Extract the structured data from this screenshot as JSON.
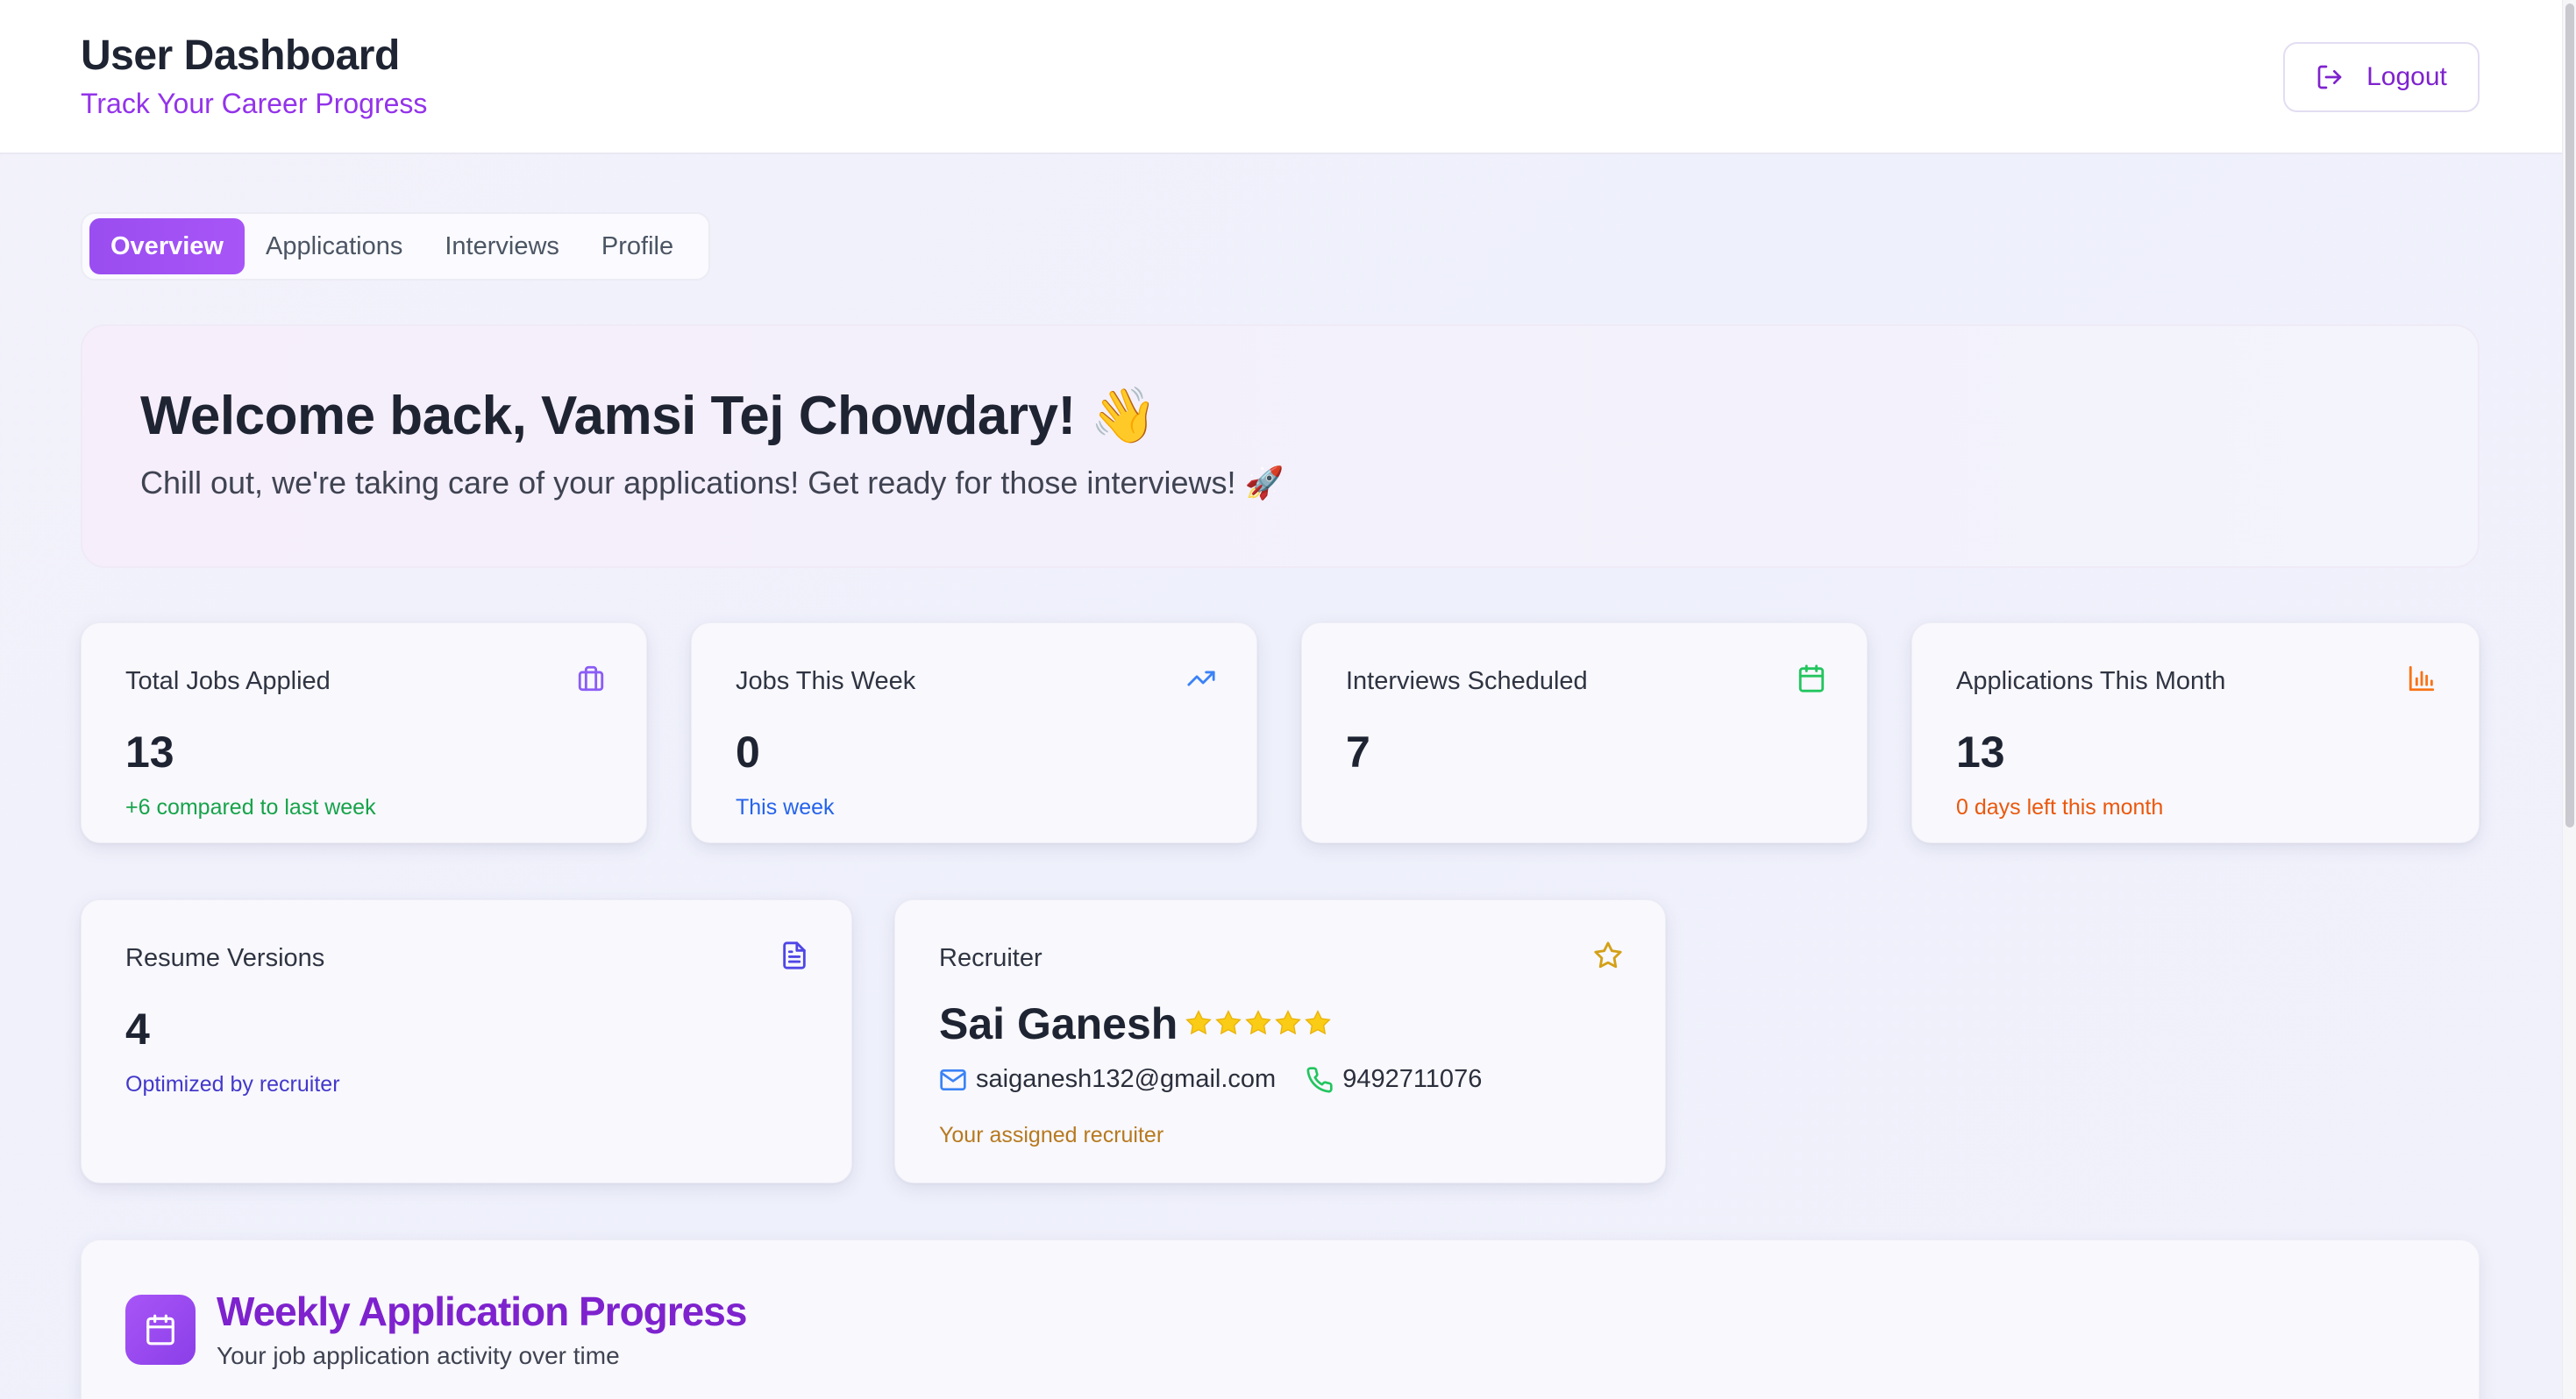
{
  "header": {
    "title": "User Dashboard",
    "subtitle": "Track Your Career Progress",
    "logout_label": "Logout"
  },
  "tabs": [
    {
      "label": "Overview",
      "active": true
    },
    {
      "label": "Applications",
      "active": false
    },
    {
      "label": "Interviews",
      "active": false
    },
    {
      "label": "Profile",
      "active": false
    }
  ],
  "welcome": {
    "title": "Welcome back, Vamsi Tej Chowdary! 👋",
    "text": "Chill out, we're taking care of your applications! Get ready for those interviews! 🚀"
  },
  "stats": [
    {
      "label": "Total Jobs Applied",
      "value": "13",
      "sub": "+6 compared to last week",
      "icon": "briefcase-icon",
      "sub_color": "#16a34a",
      "icon_color": "#8b5cf6"
    },
    {
      "label": "Jobs This Week",
      "value": "0",
      "sub": "This week",
      "icon": "trending-up-icon",
      "sub_color": "#2563eb",
      "icon_color": "#3b82f6"
    },
    {
      "label": "Interviews Scheduled",
      "value": "7",
      "sub": "",
      "icon": "calendar-icon",
      "sub_color": "#16a34a",
      "icon_color": "#22c55e"
    },
    {
      "label": "Applications This Month",
      "value": "13",
      "sub": "0 days left this month",
      "icon": "bar-chart-icon",
      "sub_color": "#ea580c",
      "icon_color": "#f97316"
    }
  ],
  "resume": {
    "label": "Resume Versions",
    "value": "4",
    "sub": "Optimized by recruiter",
    "icon": "document-icon",
    "sub_color": "#4338ca"
  },
  "recruiter": {
    "label": "Recruiter",
    "name": "Sai Ganesh",
    "rating": 5,
    "email": "saiganesh132@gmail.com",
    "phone": "9492711076",
    "note": "Your assigned recruiter",
    "icon": "star-outline-icon"
  },
  "weekly": {
    "title": "Weekly Application Progress",
    "subtitle": "Your job application activity over time",
    "icon": "calendar-icon"
  }
}
